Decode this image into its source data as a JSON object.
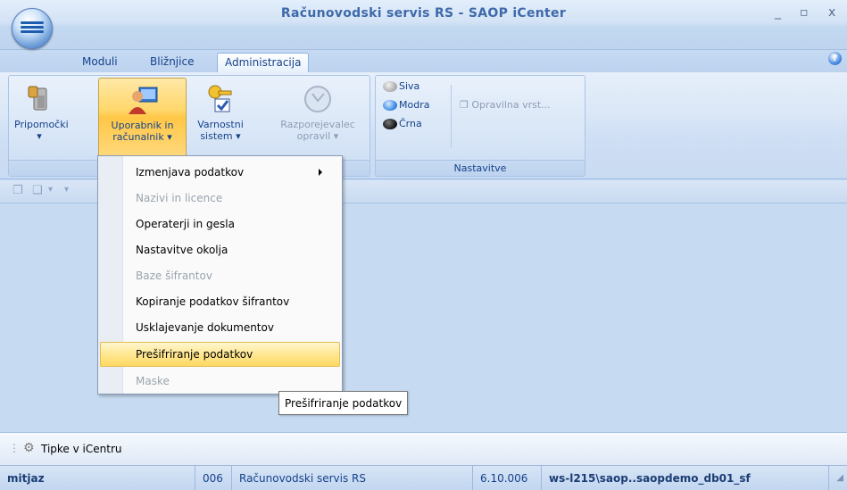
{
  "window": {
    "title": "Računovodski servis RS - SAOP iCenter",
    "controls": [
      "_",
      "▫",
      "x"
    ]
  },
  "tabs": [
    "Moduli",
    "Bližnjice",
    "Administracija"
  ],
  "active_tab": "Administracija",
  "help_glyph": "?",
  "ribbon": {
    "main_group": {
      "buttons": [
        {
          "line1": "Pripomočki",
          "line2": "",
          "icon": "tools-icon"
        },
        {
          "line1": "Uporabnik in",
          "line2": "računalnik",
          "icon": "user-computer-icon"
        },
        {
          "line1": "Varnostni",
          "line2": "sistem",
          "icon": "key-icon"
        },
        {
          "line1": "Razporejevalec",
          "line2": "opravil",
          "icon": "clock-icon"
        }
      ]
    },
    "nastavitve_group": {
      "label": "Nastavitve",
      "colors": [
        {
          "label": "Siva",
          "color": "#a8a8a8"
        },
        {
          "label": "Modra",
          "color": "#2f7fe0"
        },
        {
          "label": "Črna",
          "color": "#111111"
        }
      ],
      "opravilna_label": "Opravilna vrst..."
    }
  },
  "menu": {
    "items": [
      {
        "label": "Izmenjava podatkov",
        "disabled": false,
        "submenu": true
      },
      {
        "label": "Nazivi in licence",
        "disabled": true
      },
      {
        "label": "Operaterji in gesla",
        "disabled": false
      },
      {
        "label": "Nastavitve okolja",
        "disabled": false
      },
      {
        "label": "Baze šifrantov",
        "disabled": true
      },
      {
        "label": "Kopiranje podatkov šifrantov",
        "disabled": false
      },
      {
        "label": "Usklajevanje dokumentov",
        "disabled": false
      },
      {
        "label": "Prešifriranje podatkov",
        "disabled": false,
        "highlighted": true
      },
      {
        "label": "Maske",
        "disabled": true
      }
    ]
  },
  "tooltip": "Prešifriranje podatkov",
  "tipbar": {
    "label": "Tipke v iCentru"
  },
  "statusbar": {
    "user": "mitjaz",
    "code": "006",
    "company": "Računovodski servis RS",
    "version": "6.10.006",
    "database": "ws-l215\\saop..saopdemo_db01_sf"
  }
}
